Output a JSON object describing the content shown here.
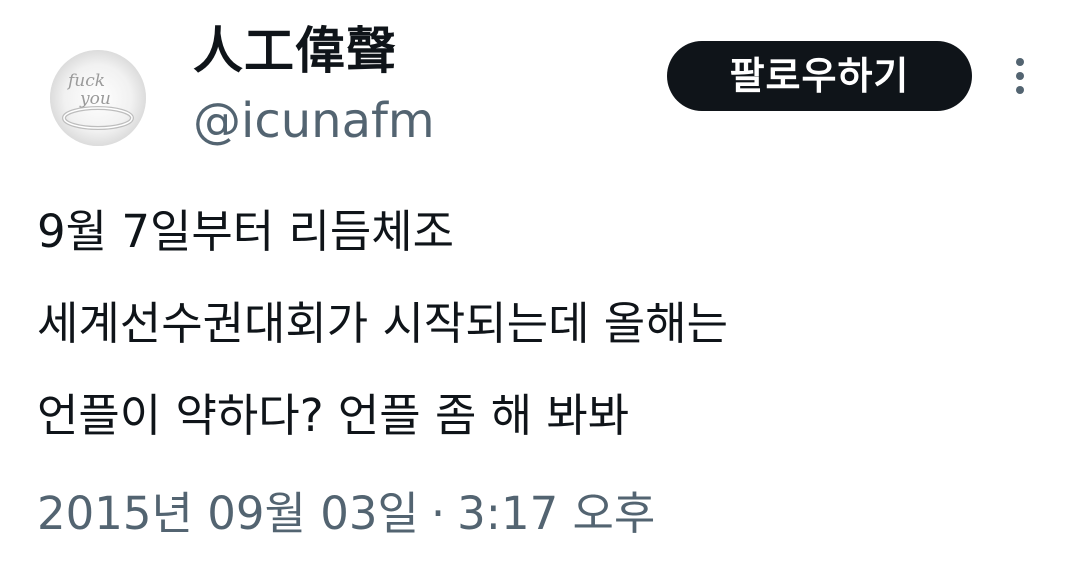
{
  "author": {
    "display_name": "人工偉聲",
    "handle": "@icunafm",
    "avatar_icon": "ring-avatar-icon",
    "avatar_ring_text_line1": "fuck",
    "avatar_ring_text_line2": "you"
  },
  "actions": {
    "follow_label": "팔로우하기",
    "more_icon": "more-vertical-icon"
  },
  "tweet": {
    "lines": [
      "9월 7일부터 리듬체조",
      "세계선수권대회가 시작되는데 올해는",
      "언플이 약하다? 언플 좀 해 봐봐"
    ],
    "date": "2015년 09월 03일",
    "separator": "·",
    "time": "3:17 오후"
  },
  "colors": {
    "text_primary": "#0f1419",
    "text_secondary": "#536471",
    "button_bg": "#0f1419",
    "button_text": "#ffffff",
    "background": "#ffffff"
  }
}
